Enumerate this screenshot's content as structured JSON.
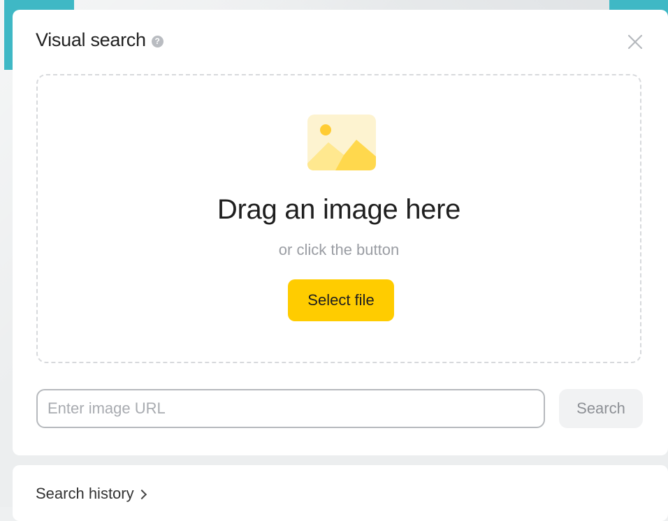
{
  "dialog": {
    "title": "Visual search",
    "help_icon": "question-circle-icon",
    "help_glyph": "?",
    "close_icon": "close-icon"
  },
  "dropzone": {
    "icon": "image-placeholder-icon",
    "heading": "Drag an image here",
    "subtext": "or click the button",
    "select_button_label": "Select file"
  },
  "url_search": {
    "input_value": "",
    "placeholder": "Enter image URL",
    "search_button_label": "Search"
  },
  "history": {
    "link_label": "Search history",
    "chevron_icon": "chevron-right-icon"
  },
  "colors": {
    "accent_yellow": "#ffcc00",
    "corner_teal": "#3fb8c5",
    "panel_bg": "#ffffff",
    "page_bg": "#eceeef"
  }
}
